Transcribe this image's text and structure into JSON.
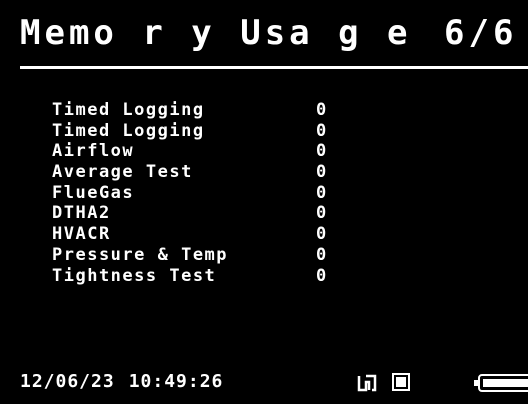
{
  "header": {
    "title": "Memo r y  Usa g e",
    "page_indicator": "6/6"
  },
  "memory_items": [
    {
      "label": "Timed Logging",
      "value": "0"
    },
    {
      "label": "Timed Logging",
      "value": "0"
    },
    {
      "label": "Airflow",
      "value": "0"
    },
    {
      "label": "Average Test",
      "value": "0"
    },
    {
      "label": "FlueGas",
      "value": "0"
    },
    {
      "label": "DTHA2",
      "value": "0"
    },
    {
      "label": "HVACR",
      "value": "0"
    },
    {
      "label": "Pressure & Temp",
      "value": "0"
    },
    {
      "label": "Tightness Test",
      "value": "0"
    }
  ],
  "status_bar": {
    "date": "12/06/23",
    "time": "10:49:26",
    "icons": [
      "connection-icon",
      "memory-card-icon",
      "battery-icon"
    ],
    "battery_level": 0.9
  },
  "colors": {
    "background": "#000000",
    "foreground": "#ffffff"
  }
}
